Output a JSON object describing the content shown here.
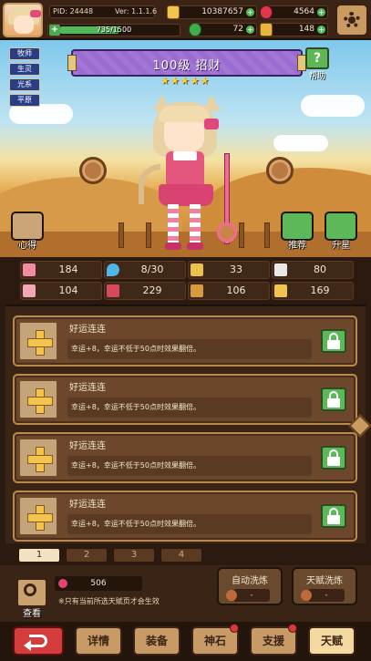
{
  "header": {
    "pid": "PID: 24448",
    "version": "Ver: 1.1.1.6",
    "exp_text": "735/1500",
    "exp_fraction": 0.49,
    "gold": "10387657",
    "ruby": "4564",
    "clover": "72",
    "key": "148"
  },
  "hero": {
    "tags": [
      "牧师",
      "生灵",
      "光系",
      "平原"
    ],
    "title": "100级 招财",
    "stars": "★★★★★",
    "help_label": "帮助",
    "left_button_label": "心得",
    "recommend_label": "推荐",
    "upgrade_label": "升星"
  },
  "stats": {
    "hp": "184",
    "mp": "8/30",
    "atk": "33",
    "speed": "80",
    "def": "104",
    "mdef": "229",
    "crit": "106",
    "luck": "169"
  },
  "talents": [
    {
      "name": "好运连连",
      "desc": "幸运+8，幸运不低于50点时效果翻倍。"
    },
    {
      "name": "好运连连",
      "desc": "幸运+8，幸运不低于50点时效果翻倍。"
    },
    {
      "name": "好运连连",
      "desc": "幸运+8，幸运不低于50点时效果翻倍。"
    },
    {
      "name": "好运连连",
      "desc": "幸运+8，幸运不低于50点时效果翻倍。"
    }
  ],
  "pages": [
    "1",
    "2",
    "3",
    "4"
  ],
  "reroll": {
    "view_label": "查看",
    "cost": "506",
    "note": "※只有当前所选天赋页才会生效",
    "auto_label": "自动洗炼",
    "auto_cost": "-",
    "talent_label": "天赋洗炼",
    "talent_cost": "-"
  },
  "nav": {
    "details": "详情",
    "equip": "装备",
    "stone": "神石",
    "support": "支援",
    "talent": "天赋"
  },
  "colors": {
    "banner": "#9a6bd0",
    "accent_green": "#5db85a",
    "panel": "#3a2416",
    "row": "#6d472c"
  }
}
